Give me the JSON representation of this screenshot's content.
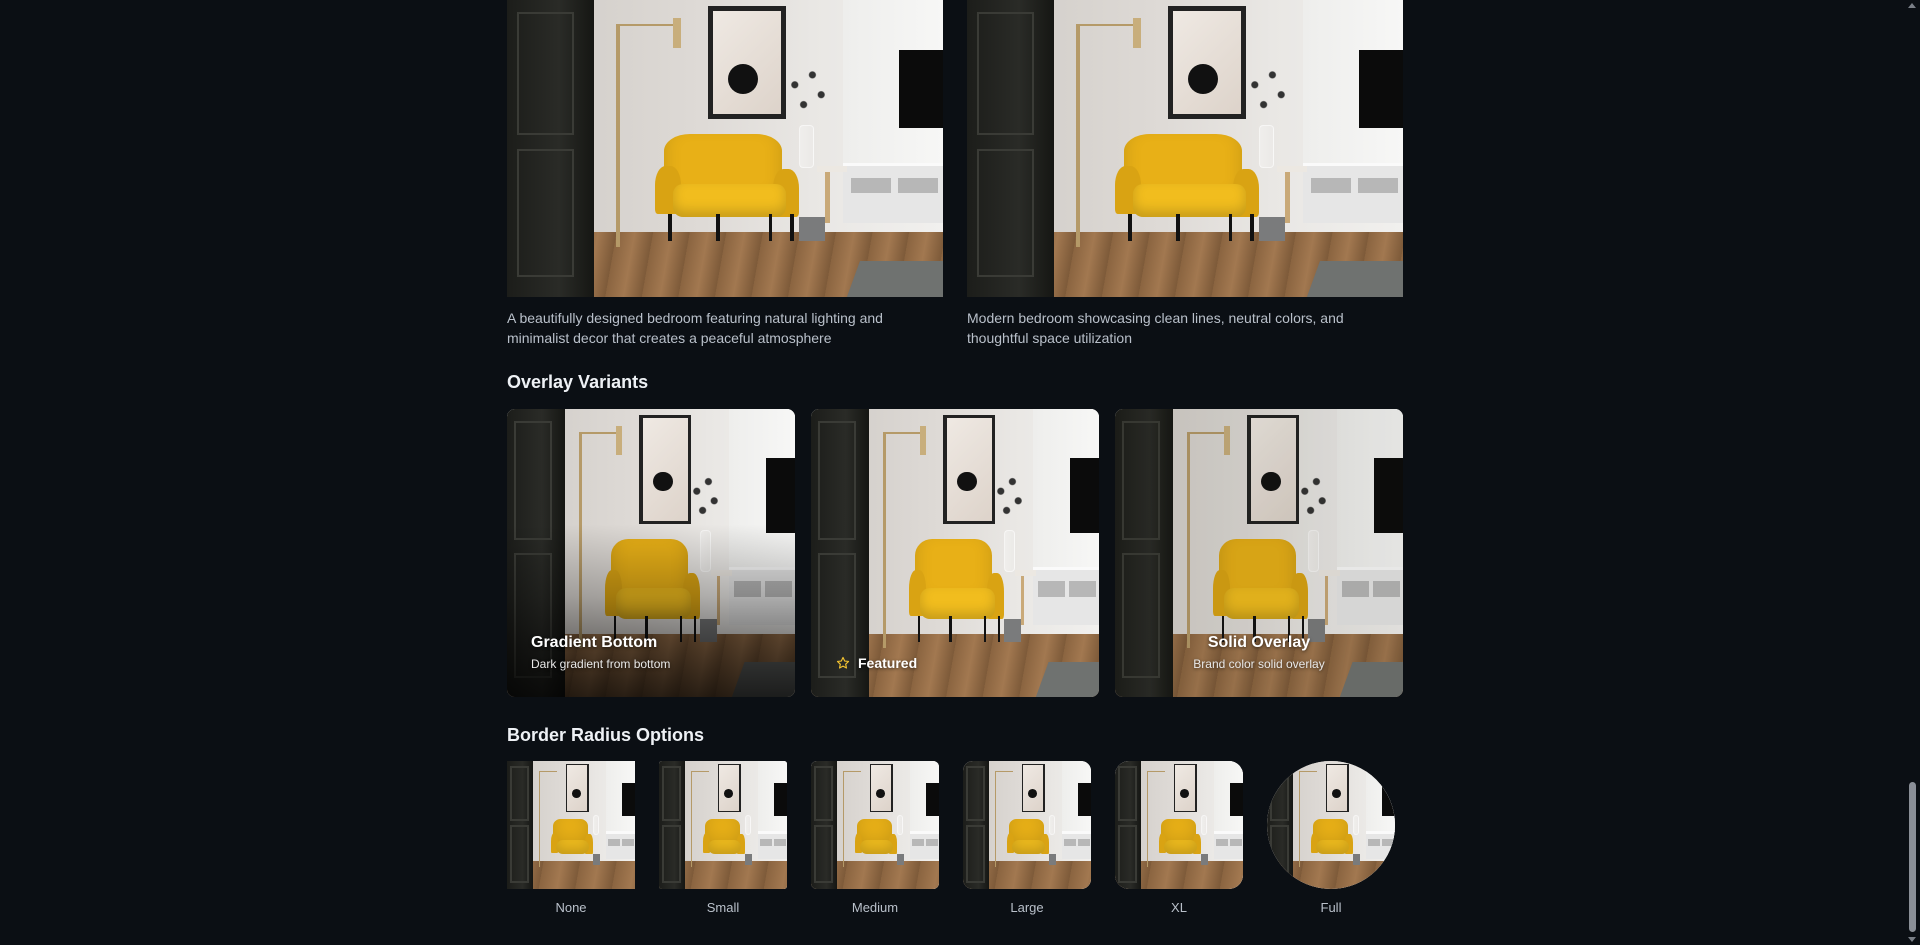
{
  "gallery": {
    "cards": [
      {
        "caption": "A beautifully designed bedroom featuring natural lighting and minimalist decor that creates a peaceful atmosphere"
      },
      {
        "caption": "Modern bedroom showcasing clean lines, neutral colors, and thoughtful space utilization"
      }
    ]
  },
  "overlay_variants": {
    "title": "Overlay Variants",
    "gradient": {
      "title": "Gradient Bottom",
      "subtitle": "Dark gradient from bottom"
    },
    "featured": {
      "label": "Featured",
      "icon": "star-icon"
    },
    "solid": {
      "title": "Solid Overlay",
      "subtitle": "Brand color solid overlay"
    }
  },
  "border_radius": {
    "title": "Border Radius Options",
    "options": [
      {
        "label": "None"
      },
      {
        "label": "Small"
      },
      {
        "label": "Medium"
      },
      {
        "label": "Large"
      },
      {
        "label": "XL"
      },
      {
        "label": "Full"
      }
    ]
  },
  "colors": {
    "background": "#0b0f14",
    "text_primary": "#eef1f5",
    "text_secondary": "#b9c0ca",
    "chair_accent": "#e8b017"
  }
}
